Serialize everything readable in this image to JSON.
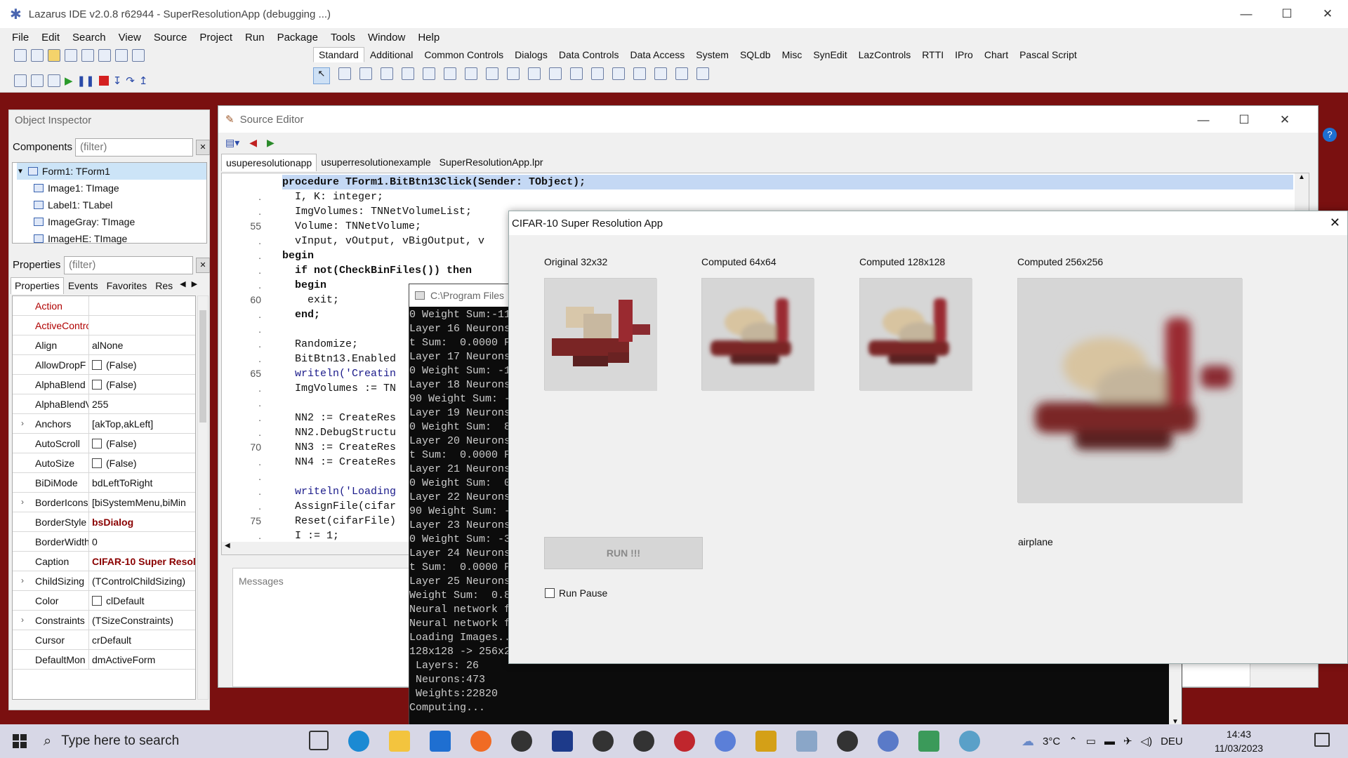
{
  "ide": {
    "title": "Lazarus IDE v2.0.8 r62944 - SuperResolutionApp (debugging ...)",
    "menu": [
      "File",
      "Edit",
      "Search",
      "View",
      "Source",
      "Project",
      "Run",
      "Package",
      "Tools",
      "Window",
      "Help"
    ],
    "palette_tabs": [
      "Standard",
      "Additional",
      "Common Controls",
      "Dialogs",
      "Data Controls",
      "Data Access",
      "System",
      "SQLdb",
      "Misc",
      "SynEdit",
      "LazControls",
      "RTTI",
      "IPro",
      "Chart",
      "Pascal Script"
    ],
    "palette_active": "Standard"
  },
  "inspector": {
    "title": "Object Inspector",
    "components_label": "Components",
    "components_filter": "(filter)",
    "tree": [
      "Form1: TForm1",
      "Image1: TImage",
      "Label1: TLabel",
      "ImageGray: TImage",
      "ImageHE: TImage"
    ],
    "properties_label": "Properties",
    "properties_filter": "(filter)",
    "tabs": [
      "Properties",
      "Events",
      "Favorites",
      "Res"
    ],
    "props": [
      {
        "name": "Action",
        "value": "",
        "red": true,
        "checkbox": false,
        "expander": false,
        "bold": false
      },
      {
        "name": "ActiveContro",
        "value": "",
        "red": true,
        "checkbox": false,
        "expander": false,
        "bold": false
      },
      {
        "name": "Align",
        "value": "alNone",
        "red": false,
        "checkbox": false,
        "expander": false,
        "bold": false
      },
      {
        "name": "AllowDropF",
        "value": "(False)",
        "red": false,
        "checkbox": true,
        "expander": false,
        "bold": false
      },
      {
        "name": "AlphaBlend",
        "value": "(False)",
        "red": false,
        "checkbox": true,
        "expander": false,
        "bold": false
      },
      {
        "name": "AlphaBlendV",
        "value": "255",
        "red": false,
        "checkbox": false,
        "expander": false,
        "bold": false
      },
      {
        "name": "Anchors",
        "value": "[akTop,akLeft]",
        "red": false,
        "checkbox": false,
        "expander": true,
        "bold": false
      },
      {
        "name": "AutoScroll",
        "value": "(False)",
        "red": false,
        "checkbox": true,
        "expander": false,
        "bold": false
      },
      {
        "name": "AutoSize",
        "value": "(False)",
        "red": false,
        "checkbox": true,
        "expander": false,
        "bold": false
      },
      {
        "name": "BiDiMode",
        "value": "bdLeftToRight",
        "red": false,
        "checkbox": false,
        "expander": false,
        "bold": false
      },
      {
        "name": "BorderIcons",
        "value": "[biSystemMenu,biMin",
        "red": false,
        "checkbox": false,
        "expander": true,
        "bold": false
      },
      {
        "name": "BorderStyle",
        "value": "bsDialog",
        "red": false,
        "checkbox": false,
        "expander": false,
        "bold": true
      },
      {
        "name": "BorderWidth",
        "value": "0",
        "red": false,
        "checkbox": false,
        "expander": false,
        "bold": false
      },
      {
        "name": "Caption",
        "value": "CIFAR-10 Super Resol",
        "red": false,
        "checkbox": false,
        "expander": false,
        "bold": true
      },
      {
        "name": "ChildSizing",
        "value": "(TControlChildSizing)",
        "red": false,
        "checkbox": false,
        "expander": true,
        "bold": false
      },
      {
        "name": "Color",
        "value": "clDefault",
        "red": false,
        "checkbox": true,
        "expander": false,
        "bold": false
      },
      {
        "name": "Constraints",
        "value": "(TSizeConstraints)",
        "red": false,
        "checkbox": false,
        "expander": true,
        "bold": false
      },
      {
        "name": "Cursor",
        "value": "crDefault",
        "red": false,
        "checkbox": false,
        "expander": false,
        "bold": false
      },
      {
        "name": "DefaultMon",
        "value": "dmActiveForm",
        "red": false,
        "checkbox": false,
        "expander": false,
        "bold": false
      }
    ]
  },
  "editor": {
    "title": "Source Editor",
    "tabs": [
      "usuperesolutionapp",
      "usuperresolutionexample",
      "SuperResolutionApp.lpr"
    ],
    "line_numbers": [
      "",
      "",
      "",
      "55",
      "",
      "",
      "",
      "",
      "60",
      "",
      "",
      "",
      "",
      "65",
      "",
      "",
      "",
      "",
      "70",
      "",
      "",
      "",
      "",
      "75"
    ],
    "lines": [
      "procedure TForm1.BitBtn13Click(Sender: TObject);",
      "  I, K: integer;",
      "  ImgVolumes: TNNetVolumeList;",
      "  Volume: TNNetVolume;",
      "  vInput, vOutput, vBigOutput, v",
      "begin",
      "  if not(CheckBinFiles()) then",
      "  begin",
      "    exit;",
      "  end;",
      "",
      "  Randomize;",
      "  BitBtn13.Enabled",
      "  writeln('Creatin",
      "  ImgVolumes := TN",
      "",
      "  NN2 := CreateRes",
      "  NN2.DebugStructu",
      "  NN3 := CreateRes",
      "  NN4 := CreateRes",
      "",
      "  writeln('Loading",
      "  AssignFile(cifar",
      "  Reset(cifarFile)",
      "  I := 1;"
    ],
    "messages_label": "Messages"
  },
  "console": {
    "title": "C:\\Program Files",
    "lines": [
      "0 Weight Sum:-11",
      "Layer 16 Neurons",
      "t Sum:  0.0000 F",
      "Layer 17 Neurons",
      "0 Weight Sum: -1",
      "Layer 18 Neurons",
      "90 Weight Sum: -",
      "Layer 19 Neurons",
      "0 Weight Sum:  8",
      "Layer 20 Neurons",
      "t Sum:  0.0000 F",
      "Layer 21 Neurons",
      "0 Weight Sum:  0",
      "Layer 22 Neurons",
      "90 Weight Sum: -",
      "Layer 23 Neurons",
      "0 Weight Sum: -3",
      "Layer 24 Neurons",
      "t Sum:  0.0000 F",
      "Layer 25 Neurons",
      "Weight Sum:  0.8",
      "Neural network f",
      "Neural network f",
      "Loading Images..",
      "128x128 -> 256x2",
      " Layers: 26",
      " Neurons:473",
      " Weights:22820",
      "Computing..."
    ]
  },
  "dialog": {
    "title": "CIFAR-10 Super Resolution App",
    "images": [
      {
        "label": "Original 32x32"
      },
      {
        "label": "Computed 64x64"
      },
      {
        "label": "Computed 128x128"
      },
      {
        "label": "Computed 256x256"
      }
    ],
    "class_label": "airplane",
    "run_button": "RUN !!!",
    "run_pause": "Run Pause"
  },
  "taskbar": {
    "search_placeholder": "Type here to search",
    "weather": "3°C",
    "language": "DEU",
    "time": "14:43",
    "date": "11/03/2023"
  }
}
